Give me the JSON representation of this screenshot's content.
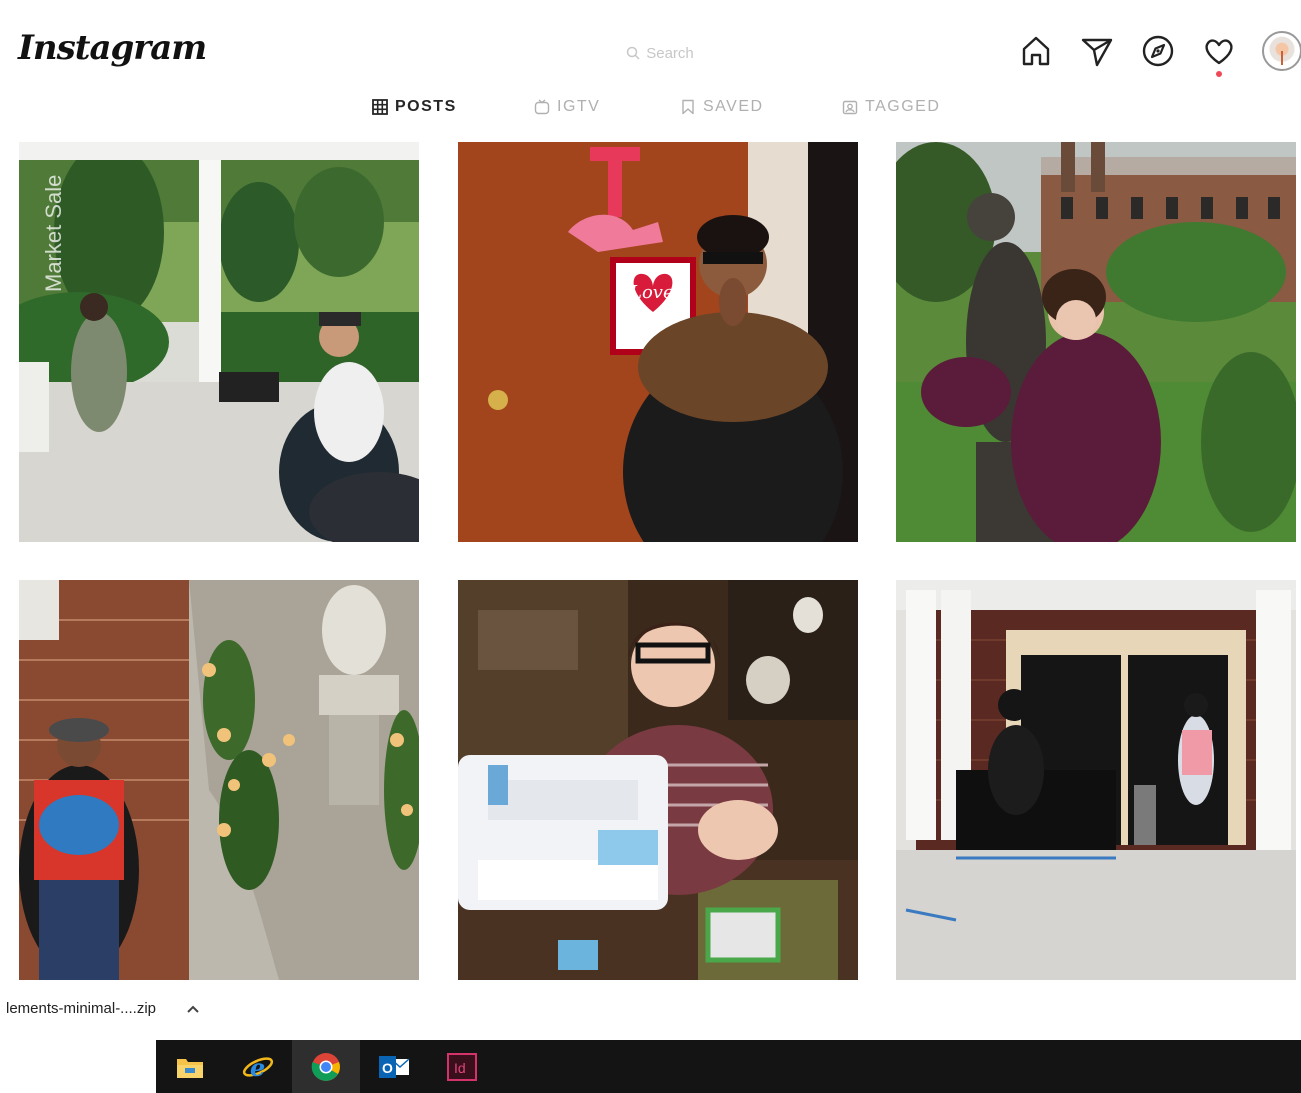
{
  "header": {
    "logo": "Instagram",
    "search_placeholder": "Search",
    "nav_icons": [
      "home-icon",
      "direct-icon",
      "explore-icon",
      "activity-icon",
      "profile-avatar"
    ],
    "notification_color": "#ed4956"
  },
  "tabs": [
    {
      "label": "POSTS",
      "icon": "grid-icon",
      "active": true
    },
    {
      "label": "IGTV",
      "icon": "igtv-icon",
      "active": false
    },
    {
      "label": "SAVED",
      "icon": "bookmark-icon",
      "active": false
    },
    {
      "label": "TAGGED",
      "icon": "tagged-icon",
      "active": false
    }
  ],
  "posts": [
    {
      "overlay_text": "Market Sale"
    },
    {
      "overlay_text": "Love"
    },
    {
      "overlay_text": ""
    },
    {
      "overlay_text": ""
    },
    {
      "overlay_text": ""
    },
    {
      "overlay_text": ""
    }
  ],
  "download_bar": {
    "file_name": "lements-minimal-....zip"
  },
  "taskbar": {
    "apps": [
      "file-explorer-icon",
      "internet-explorer-icon",
      "chrome-icon",
      "outlook-icon",
      "indesign-icon"
    ]
  }
}
